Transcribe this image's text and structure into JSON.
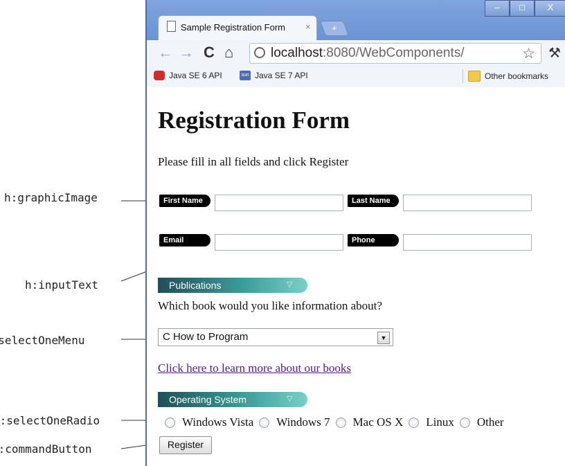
{
  "callouts": [
    "h:graphicImage",
    "h:inputText",
    "h:selectOneMenu",
    "h:selectOneRadio",
    "h:commandButton"
  ],
  "browser": {
    "tab_title": "Sample Registration Form",
    "tab_close": "×",
    "new_tab": "+",
    "window_buttons": [
      "‒",
      "□",
      "X"
    ],
    "nav": {
      "back": "←",
      "forward": "→",
      "reload": "C",
      "home": "⌂"
    },
    "url_host": "localhost",
    "url_rest": ":8080/WebComponents/",
    "star": "☆",
    "wrench": "⚒",
    "bookmarks": [
      "Java SE 6 API",
      "Java SE 7 API"
    ],
    "bookmark_icon_sun": "sun",
    "other_bookmarks": "Other bookmarks"
  },
  "page": {
    "heading": "Registration Form",
    "intro": "Please fill in all fields and click Register",
    "fields": {
      "first_name": "First Name",
      "last_name": "Last Name",
      "email": "Email",
      "phone": "Phone"
    },
    "banners": {
      "publications": "Publications",
      "os": "Operating System",
      "chevron": "▽"
    },
    "question": "Which book would you like information about?",
    "book_select_value": "C How to Program",
    "select_arrow": "▼",
    "link": "Click here to learn more about our books",
    "os_options": [
      "Windows Vista",
      "Windows 7",
      "Mac OS X",
      "Linux",
      "Other"
    ],
    "register_button": "Register"
  }
}
